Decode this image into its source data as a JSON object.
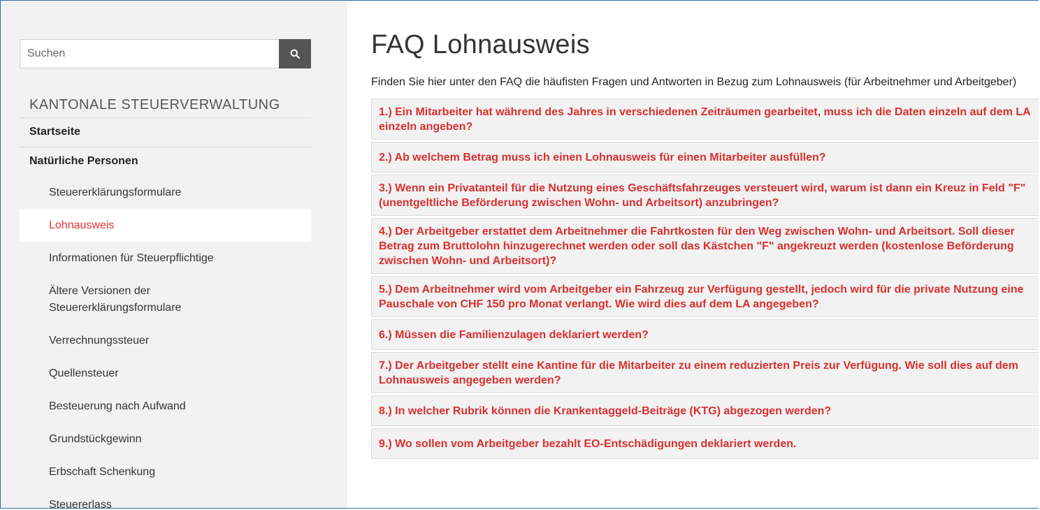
{
  "search": {
    "placeholder": "Suchen"
  },
  "sidebar": {
    "title": "KANTONALE STEUERVERWALTUNG",
    "top_items": [
      {
        "label": "Startseite"
      },
      {
        "label": "Natürliche Personen"
      }
    ],
    "sub_items": [
      {
        "label": "Steuererklärungsformulare"
      },
      {
        "label": "Lohnausweis",
        "active": true
      },
      {
        "label": "Informationen für Steuerpflichtige"
      },
      {
        "label": "Ältere Versionen der Steuererklärungsformulare"
      },
      {
        "label": "Verrechnungssteuer"
      },
      {
        "label": "Quellensteuer"
      },
      {
        "label": "Besteuerung nach Aufwand"
      },
      {
        "label": "Grundstückgewinn"
      },
      {
        "label": "Erbschaft Schenkung"
      },
      {
        "label": "Steuererlass"
      }
    ]
  },
  "main": {
    "title": "FAQ Lohnausweis",
    "intro": "Finden Sie hier unter den FAQ die häufisten Fragen und Antworten in Bezug zum Lohnausweis (für Arbeitnehmer und Arbeitgeber)",
    "faqs": [
      "1.) Ein Mitarbeiter hat während des Jahres in verschiedenen Zeiträumen gearbeitet, muss ich die Daten einzeln auf dem LA einzeln angeben?",
      "2.) Ab welchem Betrag muss ich einen Lohnausweis für einen Mitarbeiter ausfüllen?",
      "3.) Wenn ein Privatanteil für die Nutzung eines Geschäftsfahrzeuges versteuert wird, warum ist dann ein Kreuz in Feld \"F\" (unentgeltliche Beförderung zwischen Wohn- und Arbeitsort) anzubringen?",
      "4.) Der Arbeitgeber erstattet dem Arbeitnehmer die Fahrtkosten für den Weg zwischen Wohn- und Arbeitsort. Soll dieser Betrag zum Bruttolohn hinzugerechnet werden oder soll das Kästchen \"F\" angekreuzt werden (kostenlose Beförderung zwischen Wohn- und Arbeitsort)?",
      "5.) Dem Arbeitnehmer wird vom Arbeitgeber ein Fahrzeug zur Verfügung gestellt, jedoch wird für die private Nutzung eine Pauschale von CHF 150 pro Monat verlangt. Wie wird dies auf dem LA angegeben?",
      "6.) Müssen die Familienzulagen deklariert werden?",
      "7.) Der Arbeitgeber stellt eine Kantine für die Mitarbeiter zu einem reduzierten Preis zur Verfügung. Wie soll dies auf dem Lohnausweis angegeben werden?",
      "8.) In welcher Rubrik können die Krankentaggeld-Beiträge (KTG) abgezogen werden?",
      "9.) Wo sollen vom Arbeitgeber bezahlt EO-Entschädigungen deklariert werden."
    ]
  },
  "colors": {
    "accent": "#d93030",
    "sidebar_bg": "#f2f2f2",
    "search_button": "#555555",
    "frame_border": "#2f6fb0"
  },
  "icons": {
    "search_button": "search-icon"
  }
}
